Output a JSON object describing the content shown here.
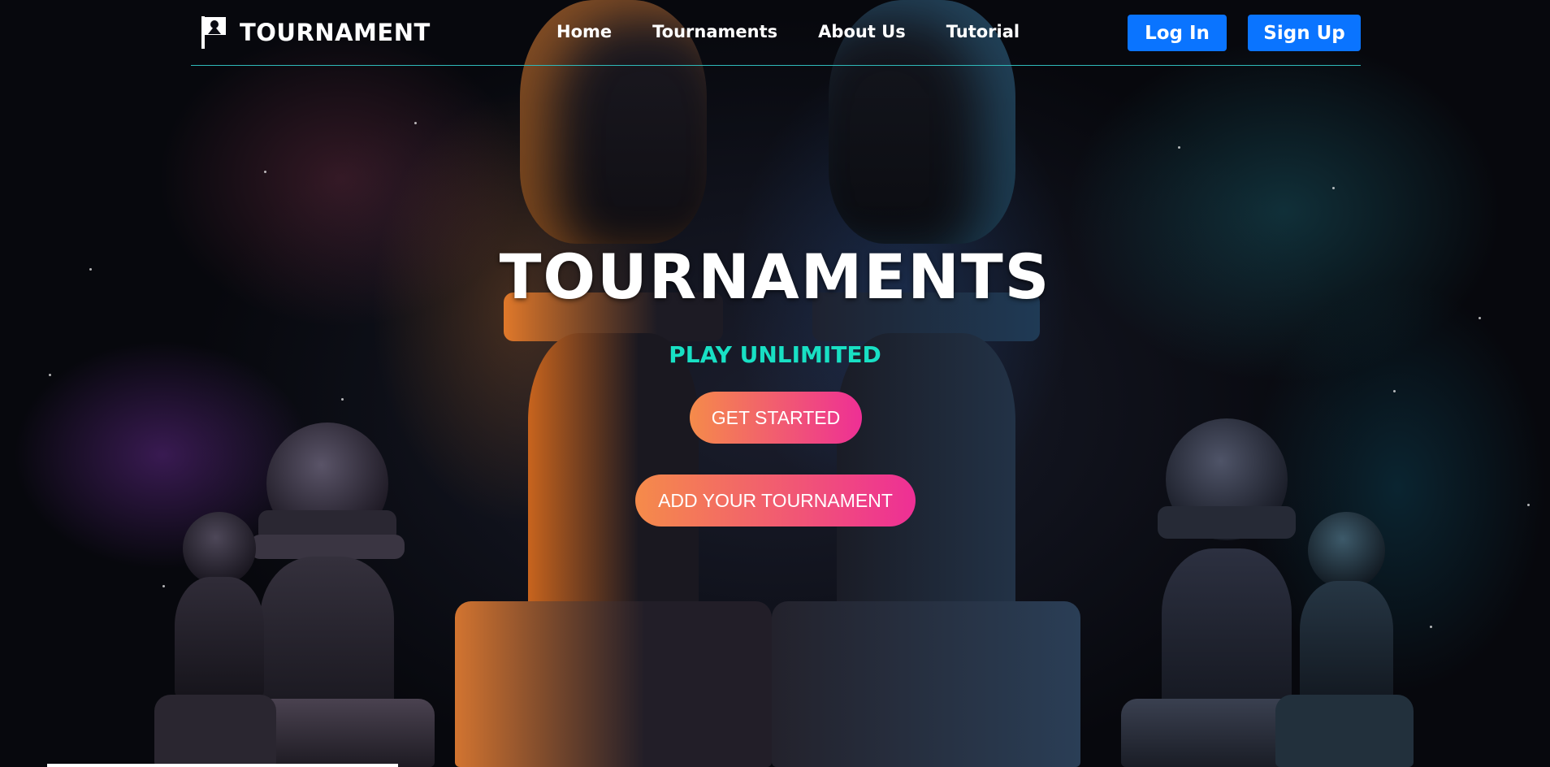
{
  "header": {
    "brand": {
      "icon": "flag-icon",
      "name": "TOURNAMENT"
    },
    "nav": [
      {
        "label": "Home"
      },
      {
        "label": "Tournaments"
      },
      {
        "label": "About Us"
      },
      {
        "label": "Tutorial"
      }
    ],
    "auth": {
      "login_label": "Log In",
      "signup_label": "Sign Up"
    }
  },
  "hero": {
    "title": "TOURNAMENTS",
    "subtitle": "PLAY UNLIMITED",
    "get_started_label": "GET STARTED",
    "add_tournament_label": "ADD YOUR TOURNAMENT"
  },
  "colors": {
    "accent_blue": "#0a74ff",
    "subtitle_teal": "#18e0c4",
    "gradient_start": "#f58b4a",
    "gradient_end": "#ee2f95",
    "header_line": "#2fb9b9"
  }
}
